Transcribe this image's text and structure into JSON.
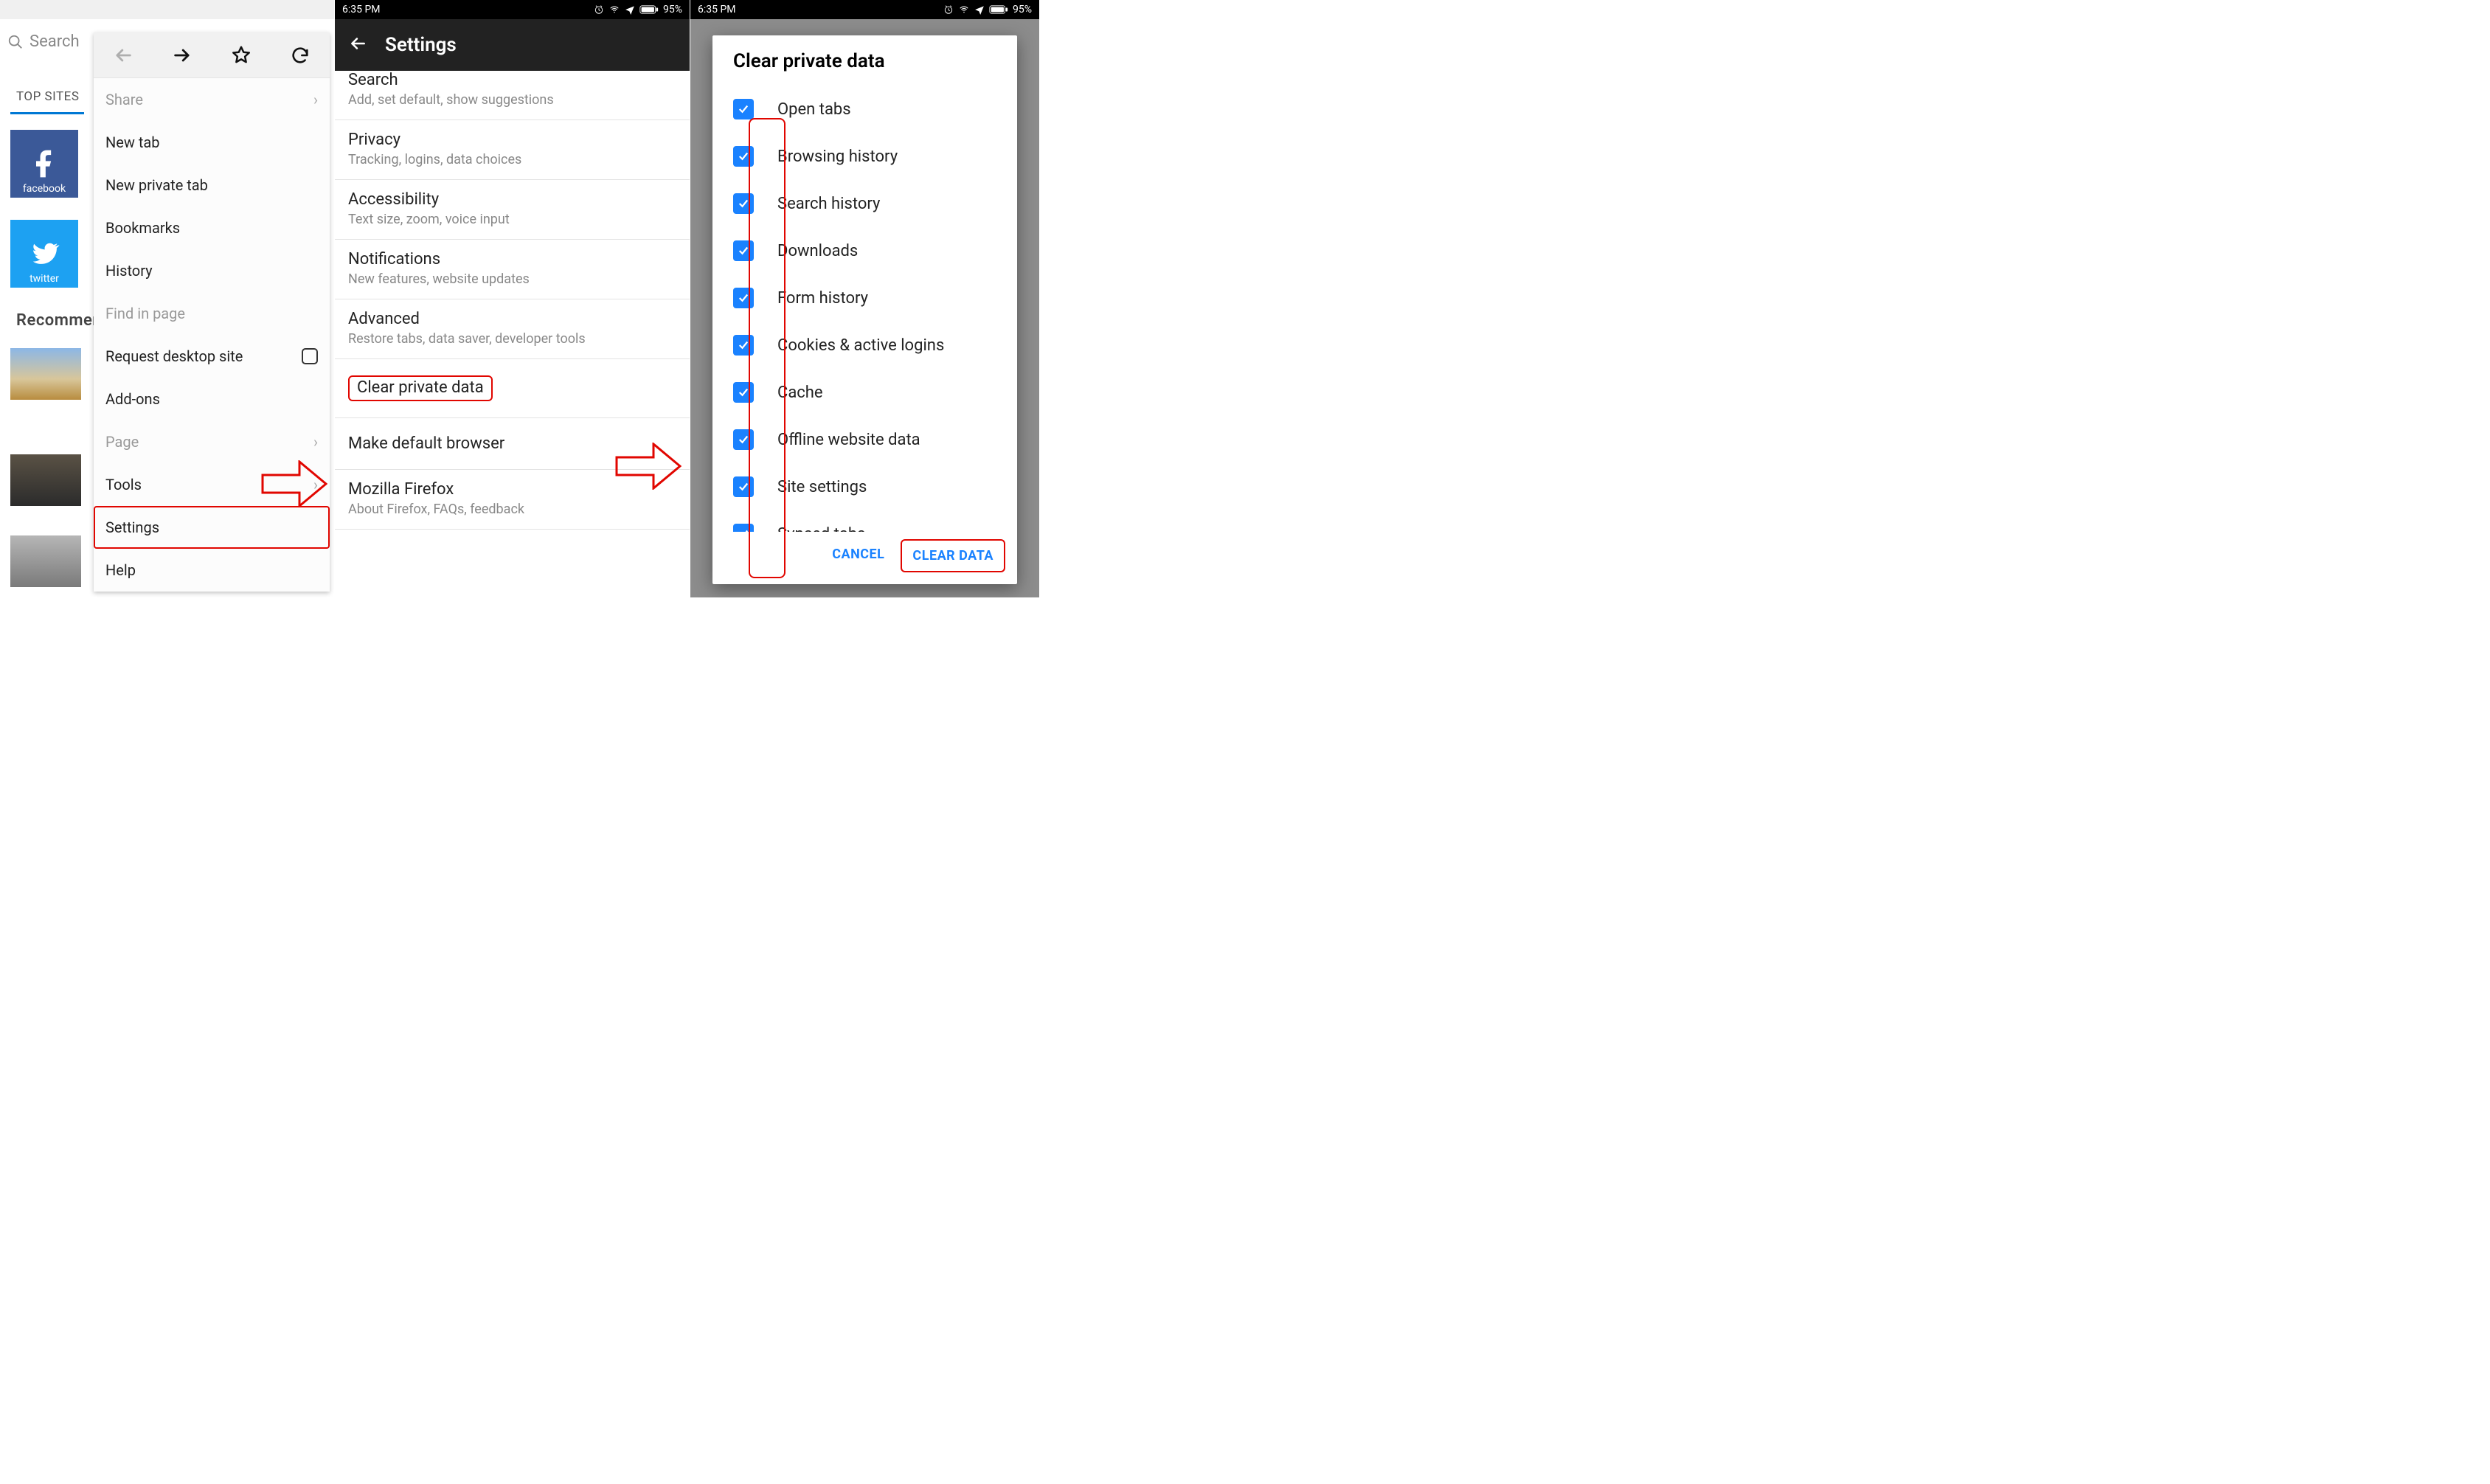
{
  "status": {
    "time": "6:35 PM",
    "battery": "95%"
  },
  "panel1": {
    "search_placeholder": "Search",
    "top_sites_label": "TOP SITES",
    "sites": {
      "facebook": "facebook",
      "twitter": "twitter"
    },
    "recommended_label": "Recommended",
    "menu": {
      "share": "Share",
      "new_tab": "New tab",
      "new_private_tab": "New private tab",
      "bookmarks": "Bookmarks",
      "history": "History",
      "find_in_page": "Find in page",
      "request_desktop": "Request desktop site",
      "addons": "Add-ons",
      "page": "Page",
      "tools": "Tools",
      "settings": "Settings",
      "help": "Help"
    }
  },
  "panel2": {
    "title": "Settings",
    "items": [
      {
        "t": "Search",
        "d": "Add, set default, show suggestions"
      },
      {
        "t": "Privacy",
        "d": "Tracking, logins, data choices"
      },
      {
        "t": "Accessibility",
        "d": "Text size, zoom, voice input"
      },
      {
        "t": "Notifications",
        "d": "New features, website updates"
      },
      {
        "t": "Advanced",
        "d": "Restore tabs, data saver, developer tools"
      },
      {
        "t": "Clear private data"
      },
      {
        "t": "Make default browser"
      },
      {
        "t": "Mozilla Firefox",
        "d": "About Firefox, FAQs, feedback"
      }
    ]
  },
  "panel3": {
    "dialog_title": "Clear private data",
    "options": [
      "Open tabs",
      "Browsing history",
      "Search history",
      "Downloads",
      "Form history",
      "Cookies & active logins",
      "Cache",
      "Offline website data",
      "Site settings",
      "Synced tabs"
    ],
    "cancel": "CANCEL",
    "clear": "CLEAR DATA"
  }
}
